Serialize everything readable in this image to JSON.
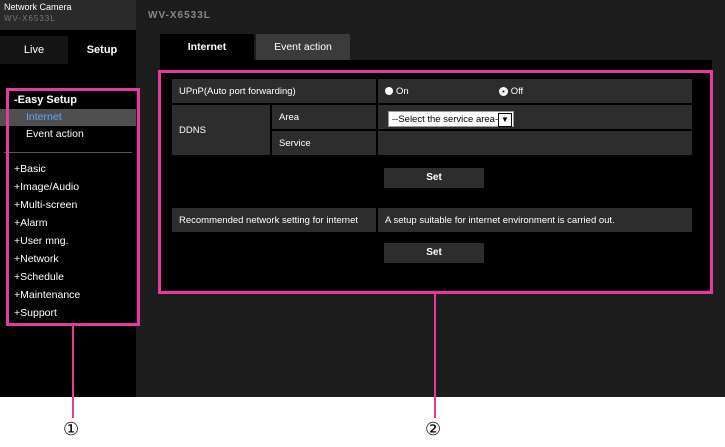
{
  "brand": {
    "title": "Network Camera",
    "model": "WV-X6533L"
  },
  "camera_title": "WV-X6533L",
  "mode_tabs": {
    "live": "Live",
    "setup": "Setup"
  },
  "sidebar": {
    "easy_setup_head": "-Easy Setup",
    "easy_setup_items": [
      {
        "label": "Internet",
        "active": true
      },
      {
        "label": "Event action",
        "active": false
      }
    ],
    "items": [
      "+Basic",
      "+Image/Audio",
      "+Multi-screen",
      "+Alarm",
      "+User mng.",
      "+Network",
      "+Schedule",
      "+Maintenance",
      "+Support"
    ]
  },
  "tabs": [
    {
      "label": "Internet",
      "active": true
    },
    {
      "label": "Event action",
      "active": false
    }
  ],
  "form": {
    "upnp_label": "UPnP(Auto port forwarding)",
    "upnp_on_label": "On",
    "upnp_off_label": "Off",
    "upnp_selected": "Off",
    "ddns_label": "DDNS",
    "area_label": "Area",
    "area_value": "--Select the service area--",
    "service_label": "Service",
    "set_label_1": "Set",
    "recommended_label": "Recommended network setting for internet",
    "recommended_desc": "A setup suitable for internet environment is carried out.",
    "set_label_2": "Set"
  },
  "callouts": {
    "left": "①",
    "right": "②"
  },
  "colors": {
    "highlight": "#e43b9c",
    "active_link": "#5aa8ff"
  }
}
